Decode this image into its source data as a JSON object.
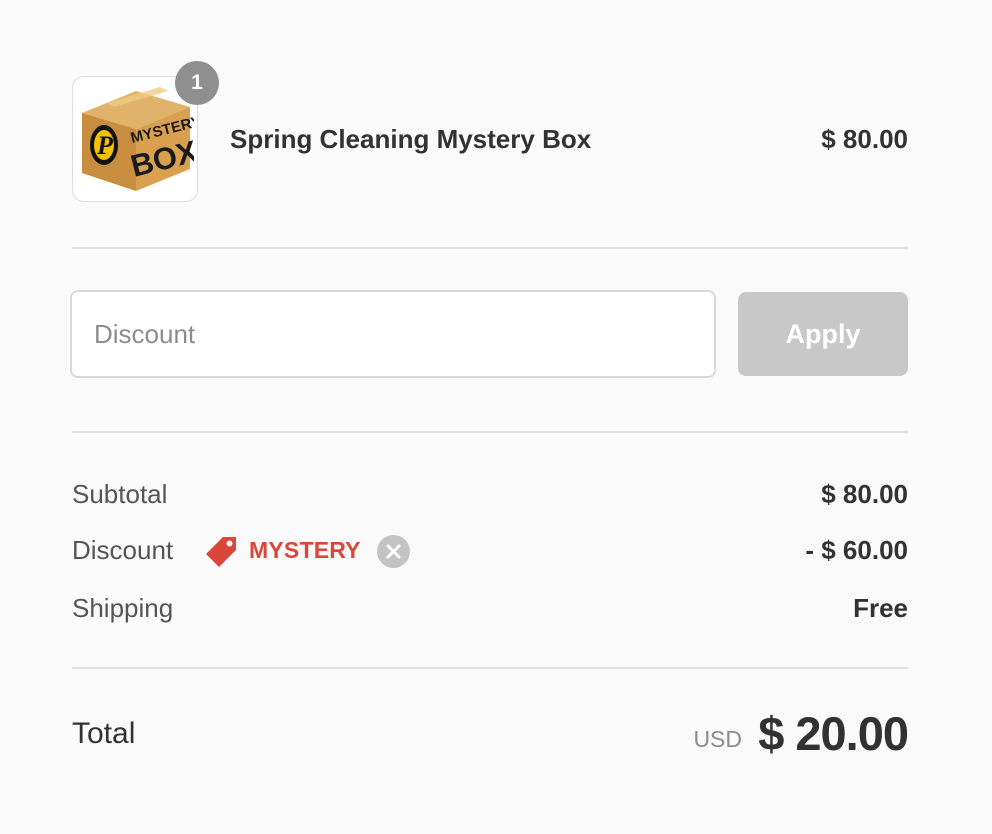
{
  "product": {
    "quantity": "1",
    "name": "Spring Cleaning Mystery Box",
    "price": "$ 80.00",
    "image": {
      "top_text": "MYSTERY",
      "bottom_text": "BOX",
      "logo_letter": "P"
    }
  },
  "discount_form": {
    "placeholder": "Discount",
    "value": "",
    "apply_label": "Apply"
  },
  "summary": {
    "subtotal_label": "Subtotal",
    "subtotal_value": "$ 80.00",
    "discount_label": "Discount",
    "discount_code": "MYSTERY",
    "discount_value": "- $ 60.00",
    "shipping_label": "Shipping",
    "shipping_value": "Free"
  },
  "total": {
    "label": "Total",
    "currency": "USD",
    "amount": "$ 20.00"
  },
  "colors": {
    "background": "#fafafa",
    "discount_code": "#d9473b",
    "apply_button_disabled": "#c8c8c8",
    "badge": "#8f8f8f"
  },
  "icons": {
    "tag": "tag-icon",
    "remove": "close-circle-icon"
  }
}
